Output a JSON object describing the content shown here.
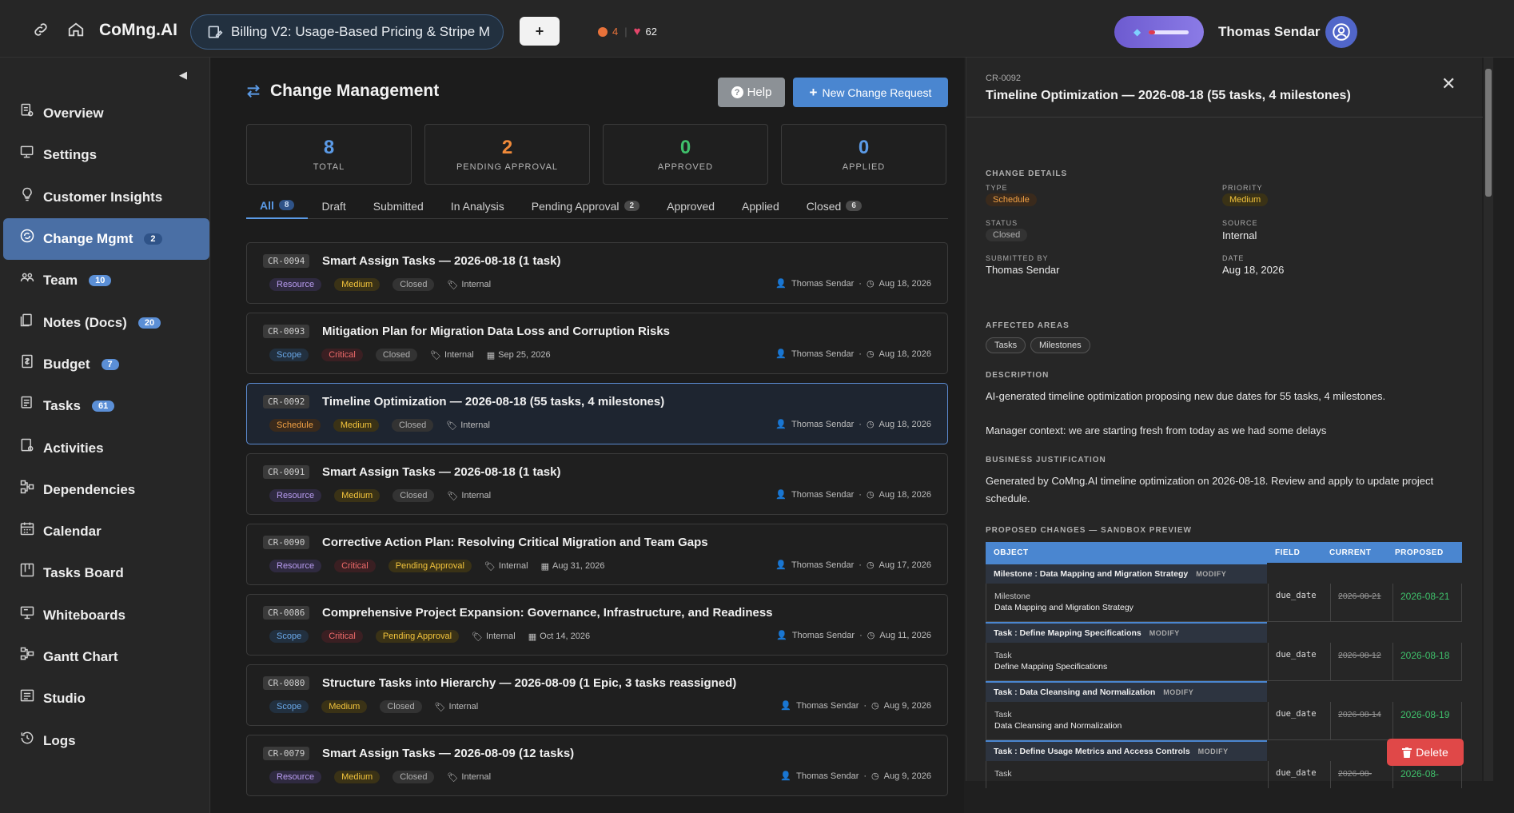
{
  "topbar": {
    "brand": "CoMng.AI",
    "project_tab": "Billing V2: Usage-Based Pricing & Stripe M",
    "plus_label": "+",
    "alerts_count": "4",
    "likes_count": "62",
    "user_name": "Thomas Sendar"
  },
  "sidebar": {
    "items": [
      {
        "label": "Overview",
        "icon": "overview-icon",
        "badge": ""
      },
      {
        "label": "Settings",
        "icon": "settings-icon",
        "badge": ""
      },
      {
        "label": "Customer Insights",
        "icon": "lightbulb-icon",
        "badge": ""
      },
      {
        "label": "Change Mgmt",
        "icon": "change-icon",
        "badge": "2",
        "active": true
      },
      {
        "label": "Team",
        "icon": "team-icon",
        "badge": "10"
      },
      {
        "label": "Notes (Docs)",
        "icon": "notes-icon",
        "badge": "20"
      },
      {
        "label": "Budget",
        "icon": "budget-icon",
        "badge": "7"
      },
      {
        "label": "Tasks",
        "icon": "tasks-icon",
        "badge": "61"
      },
      {
        "label": "Activities",
        "icon": "activities-icon",
        "badge": ""
      },
      {
        "label": "Dependencies",
        "icon": "dependencies-icon",
        "badge": ""
      },
      {
        "label": "Calendar",
        "icon": "calendar-icon",
        "badge": ""
      },
      {
        "label": "Tasks Board",
        "icon": "board-icon",
        "badge": ""
      },
      {
        "label": "Whiteboards",
        "icon": "whiteboard-icon",
        "badge": ""
      },
      {
        "label": "Gantt Chart",
        "icon": "gantt-icon",
        "badge": ""
      },
      {
        "label": "Studio",
        "icon": "studio-icon",
        "badge": ""
      },
      {
        "label": "Logs",
        "icon": "logs-icon",
        "badge": ""
      }
    ]
  },
  "main": {
    "title": "Change Management",
    "help_label": "Help",
    "new_label": "New Change Request",
    "stats": [
      {
        "value": "8",
        "label": "TOTAL",
        "color": "#5b9ae6"
      },
      {
        "value": "2",
        "label": "PENDING APPROVAL",
        "color": "#f08a3a"
      },
      {
        "value": "0",
        "label": "APPROVED",
        "color": "#3fc06b"
      },
      {
        "value": "0",
        "label": "APPLIED",
        "color": "#5b9ae6"
      }
    ],
    "tabs": [
      {
        "label": "All",
        "count": "8",
        "active": true
      },
      {
        "label": "Draft",
        "count": ""
      },
      {
        "label": "Submitted",
        "count": ""
      },
      {
        "label": "In Analysis",
        "count": ""
      },
      {
        "label": "Pending Approval",
        "count": "2"
      },
      {
        "label": "Approved",
        "count": ""
      },
      {
        "label": "Applied",
        "count": ""
      },
      {
        "label": "Closed",
        "count": "6"
      }
    ],
    "requests": [
      {
        "id": "CR-0094",
        "title": "Smart Assign Tasks — 2026-08-18 (1 task)",
        "type": "Resource",
        "priority": "Medium",
        "status": "Closed",
        "source": "Internal",
        "due": "",
        "author": "Thomas Sendar",
        "date": "Aug 18, 2026"
      },
      {
        "id": "CR-0093",
        "title": "Mitigation Plan for Migration Data Loss and Corruption Risks",
        "type": "Scope",
        "priority": "Critical",
        "status": "Closed",
        "source": "Internal",
        "due": "Sep 25, 2026",
        "author": "Thomas Sendar",
        "date": "Aug 18, 2026"
      },
      {
        "id": "CR-0092",
        "title": "Timeline Optimization — 2026-08-18 (55 tasks, 4 milestones)",
        "type": "Schedule",
        "priority": "Medium",
        "status": "Closed",
        "source": "Internal",
        "due": "",
        "author": "Thomas Sendar",
        "date": "Aug 18, 2026",
        "selected": true
      },
      {
        "id": "CR-0091",
        "title": "Smart Assign Tasks — 2026-08-18 (1 task)",
        "type": "Resource",
        "priority": "Medium",
        "status": "Closed",
        "source": "Internal",
        "due": "",
        "author": "Thomas Sendar",
        "date": "Aug 18, 2026"
      },
      {
        "id": "CR-0090",
        "title": "Corrective Action Plan: Resolving Critical Migration and Team Gaps",
        "type": "Resource",
        "priority": "Critical",
        "status": "Pending Approval",
        "source": "Internal",
        "due": "Aug 31, 2026",
        "author": "Thomas Sendar",
        "date": "Aug 17, 2026"
      },
      {
        "id": "CR-0086",
        "title": "Comprehensive Project Expansion: Governance, Infrastructure, and Readiness",
        "type": "Scope",
        "priority": "Critical",
        "status": "Pending Approval",
        "source": "Internal",
        "due": "Oct 14, 2026",
        "author": "Thomas Sendar",
        "date": "Aug 11, 2026"
      },
      {
        "id": "CR-0080",
        "title": "Structure Tasks into Hierarchy — 2026-08-09 (1 Epic, 3 tasks reassigned)",
        "type": "Scope",
        "priority": "Medium",
        "status": "Closed",
        "source": "Internal",
        "due": "",
        "author": "Thomas Sendar",
        "date": "Aug 9, 2026"
      },
      {
        "id": "CR-0079",
        "title": "Smart Assign Tasks — 2026-08-09 (12 tasks)",
        "type": "Resource",
        "priority": "Medium",
        "status": "Closed",
        "source": "Internal",
        "due": "",
        "author": "Thomas Sendar",
        "date": "Aug 9, 2026"
      }
    ]
  },
  "panel": {
    "id": "CR-0092",
    "title": "Timeline Optimization — 2026-08-18 (55 tasks, 4 milestones)",
    "details_heading": "CHANGE DETAILS",
    "type_label": "TYPE",
    "type_value": "Schedule",
    "priority_label": "PRIORITY",
    "priority_value": "Medium",
    "status_label": "STATUS",
    "status_value": "Closed",
    "source_label": "SOURCE",
    "source_value": "Internal",
    "submitted_label": "SUBMITTED BY",
    "submitted_value": "Thomas Sendar",
    "date_label": "DATE",
    "date_value": "Aug 18, 2026",
    "areas_heading": "AFFECTED AREAS",
    "areas": [
      "Tasks",
      "Milestones"
    ],
    "description_heading": "DESCRIPTION",
    "description_1": "AI-generated timeline optimization proposing new due dates for 55 tasks, 4 milestones.",
    "description_2": "Manager context: we are starting fresh from today as we had some delays",
    "justification_heading": "BUSINESS JUSTIFICATION",
    "justification": "Generated by CoMng.AI timeline optimization on 2026-08-18. Review and apply to update project schedule.",
    "proposed_heading": "PROPOSED CHANGES — SANDBOX PREVIEW",
    "columns": [
      "OBJECT",
      "FIELD",
      "CURRENT",
      "PROPOSED"
    ],
    "modify_label": "MODIFY",
    "changes": [
      {
        "group": "Milestone : Data Mapping and Migration Strategy",
        "kind": "Milestone",
        "name": "Data Mapping and Migration Strategy",
        "field": "due_date",
        "current": "2026-08-21",
        "proposed": "2026-08-21"
      },
      {
        "group": "Task : Define Mapping Specifications",
        "kind": "Task",
        "name": "Define Mapping Specifications",
        "field": "due_date",
        "current": "2026-08-12",
        "proposed": "2026-08-18"
      },
      {
        "group": "Task : Data Cleansing and Normalization",
        "kind": "Task",
        "name": "Data Cleansing and Normalization",
        "field": "due_date",
        "current": "2026-08-14",
        "proposed": "2026-08-19"
      },
      {
        "group": "Task : Define Usage Metrics and Access Controls",
        "kind": "Task",
        "name": "",
        "field": "due_date",
        "current": "2026-08-",
        "proposed": "2026-08-"
      }
    ],
    "delete_label": "Delete"
  }
}
